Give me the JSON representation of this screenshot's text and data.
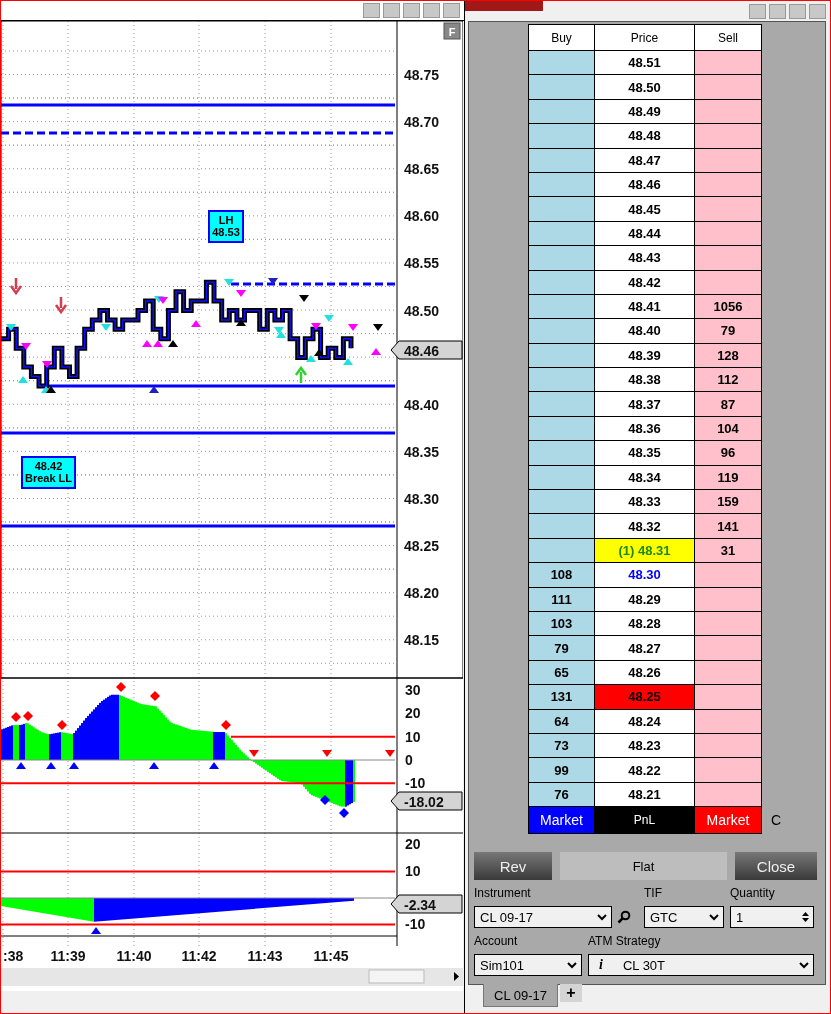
{
  "chart": {
    "button": "F",
    "price_axis": [
      "48.75",
      "48.70",
      "48.65",
      "48.60",
      "48.55",
      "48.50",
      "48.40",
      "48.35",
      "48.30",
      "48.25",
      "48.20",
      "48.15"
    ],
    "last_price": "48.46",
    "labels": [
      {
        "lines": [
          "LH",
          "48.53"
        ]
      },
      {
        "lines": [
          "48.42",
          "Break LL"
        ]
      }
    ],
    "oscillator_1": {
      "axis": [
        "30",
        "20",
        "10",
        "0",
        "-10"
      ],
      "reading": "-18.02"
    },
    "oscillator_2": {
      "axis": [
        "20",
        "10",
        "-10"
      ],
      "reading": "-2.34"
    },
    "time_axis": [
      ":38",
      "11:39",
      "11:40",
      "11:42",
      "11:43",
      "11:45"
    ]
  },
  "dom": {
    "columns": [
      "Buy",
      "Price",
      "Sell"
    ],
    "rows": [
      {
        "price": "48.51",
        "kind": "plain"
      },
      {
        "price": "48.50",
        "kind": "plain"
      },
      {
        "price": "48.49",
        "kind": "plain"
      },
      {
        "price": "48.48",
        "kind": "plain"
      },
      {
        "price": "48.47",
        "kind": "plain"
      },
      {
        "price": "48.46",
        "kind": "plain"
      },
      {
        "price": "48.45",
        "kind": "plain"
      },
      {
        "price": "48.44",
        "kind": "plain"
      },
      {
        "price": "48.43",
        "kind": "plain"
      },
      {
        "price": "48.42",
        "kind": "plain"
      },
      {
        "price": "48.41",
        "sell": "1056",
        "kind": "plain"
      },
      {
        "price": "48.40",
        "sell": "79",
        "kind": "plain"
      },
      {
        "price": "48.39",
        "sell": "128",
        "kind": "plain"
      },
      {
        "price": "48.38",
        "sell": "112",
        "kind": "plain"
      },
      {
        "price": "48.37",
        "sell": "87",
        "kind": "plain"
      },
      {
        "price": "48.36",
        "sell": "104",
        "kind": "plain"
      },
      {
        "price": "48.35",
        "sell": "96",
        "kind": "plain"
      },
      {
        "price": "48.34",
        "sell": "119",
        "kind": "plain"
      },
      {
        "price": "48.33",
        "sell": "159",
        "kind": "plain"
      },
      {
        "price": "48.32",
        "sell": "141",
        "kind": "plain"
      },
      {
        "price": "(1) 48.31",
        "sell": "31",
        "kind": "position"
      },
      {
        "buy": "108",
        "price": "48.30",
        "kind": "bid"
      },
      {
        "buy": "111",
        "price": "48.29",
        "kind": "plain"
      },
      {
        "buy": "103",
        "price": "48.28",
        "kind": "plain"
      },
      {
        "buy": "79",
        "price": "48.27",
        "kind": "plain"
      },
      {
        "buy": "65",
        "price": "48.26",
        "kind": "plain"
      },
      {
        "buy": "131",
        "price": "48.25",
        "kind": "last"
      },
      {
        "buy": "64",
        "price": "48.24",
        "kind": "plain"
      },
      {
        "buy": "73",
        "price": "48.23",
        "kind": "plain"
      },
      {
        "buy": "99",
        "price": "48.22",
        "kind": "plain"
      },
      {
        "buy": "76",
        "price": "48.21",
        "kind": "plain"
      }
    ],
    "footer": {
      "buy_market": "Market",
      "pnl": "PnL",
      "sell_market": "Market",
      "side": "C"
    },
    "rev_button": "Rev",
    "position": "Flat",
    "close_button": "Close",
    "instrument": {
      "label": "Instrument",
      "value": "CL 09-17"
    },
    "tif": {
      "label": "TIF",
      "value": "GTC"
    },
    "quantity": {
      "label": "Quantity",
      "value": "1"
    },
    "account": {
      "label": "Account",
      "value": "Sim101"
    },
    "atm_strategy": {
      "label": "ATM Strategy",
      "info": "i",
      "value": "CL 30T"
    }
  },
  "tabs": [
    {
      "label": "CL 09-17",
      "selected": true
    }
  ],
  "add_tab": "+"
}
